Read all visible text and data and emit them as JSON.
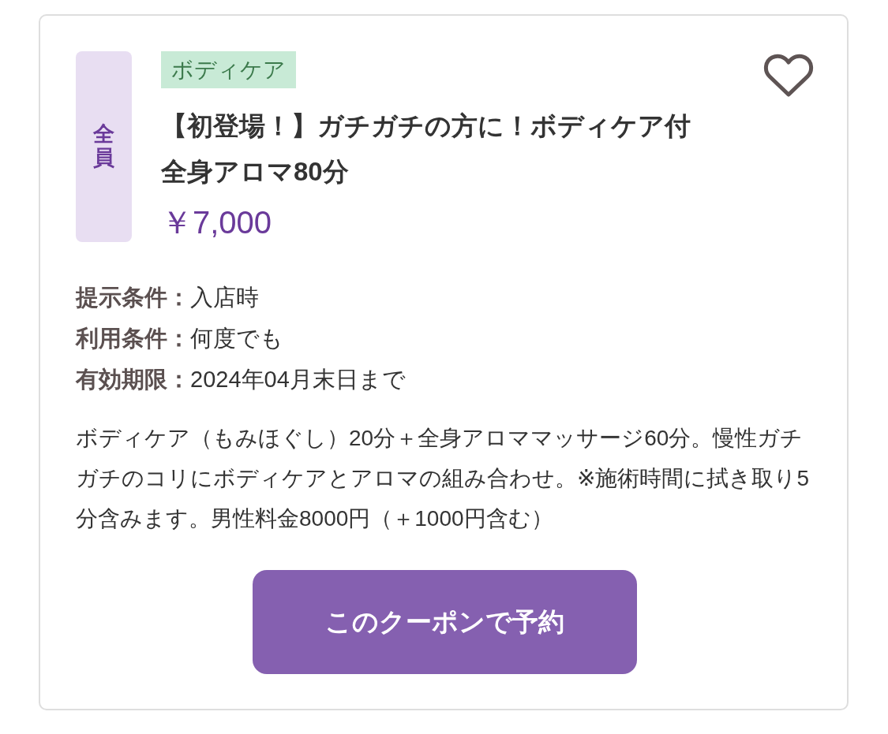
{
  "coupon": {
    "target_badge": "全員",
    "category_tag": "ボディケア",
    "favorite": {
      "selected": false
    },
    "title": "【初登場！】ガチガチの方に！ボディケア付全身アロマ80分",
    "price": "￥7,000",
    "conditions": [
      {
        "label": "提示条件：",
        "value": "入店時"
      },
      {
        "label": "利用条件：",
        "value": "何度でも"
      },
      {
        "label": "有効期限：",
        "value": "2024年04月末日まで"
      }
    ],
    "description": "ボディケア（もみほぐし）20分＋全身アロママッサージ60分。慢性ガチガチのコリにボディケアとアロマの組み合わせ。※施術時間に拭き取り5分含みます。男性料金8000円（＋1000円含む）",
    "reserve_button": "このクーポンで予約"
  }
}
